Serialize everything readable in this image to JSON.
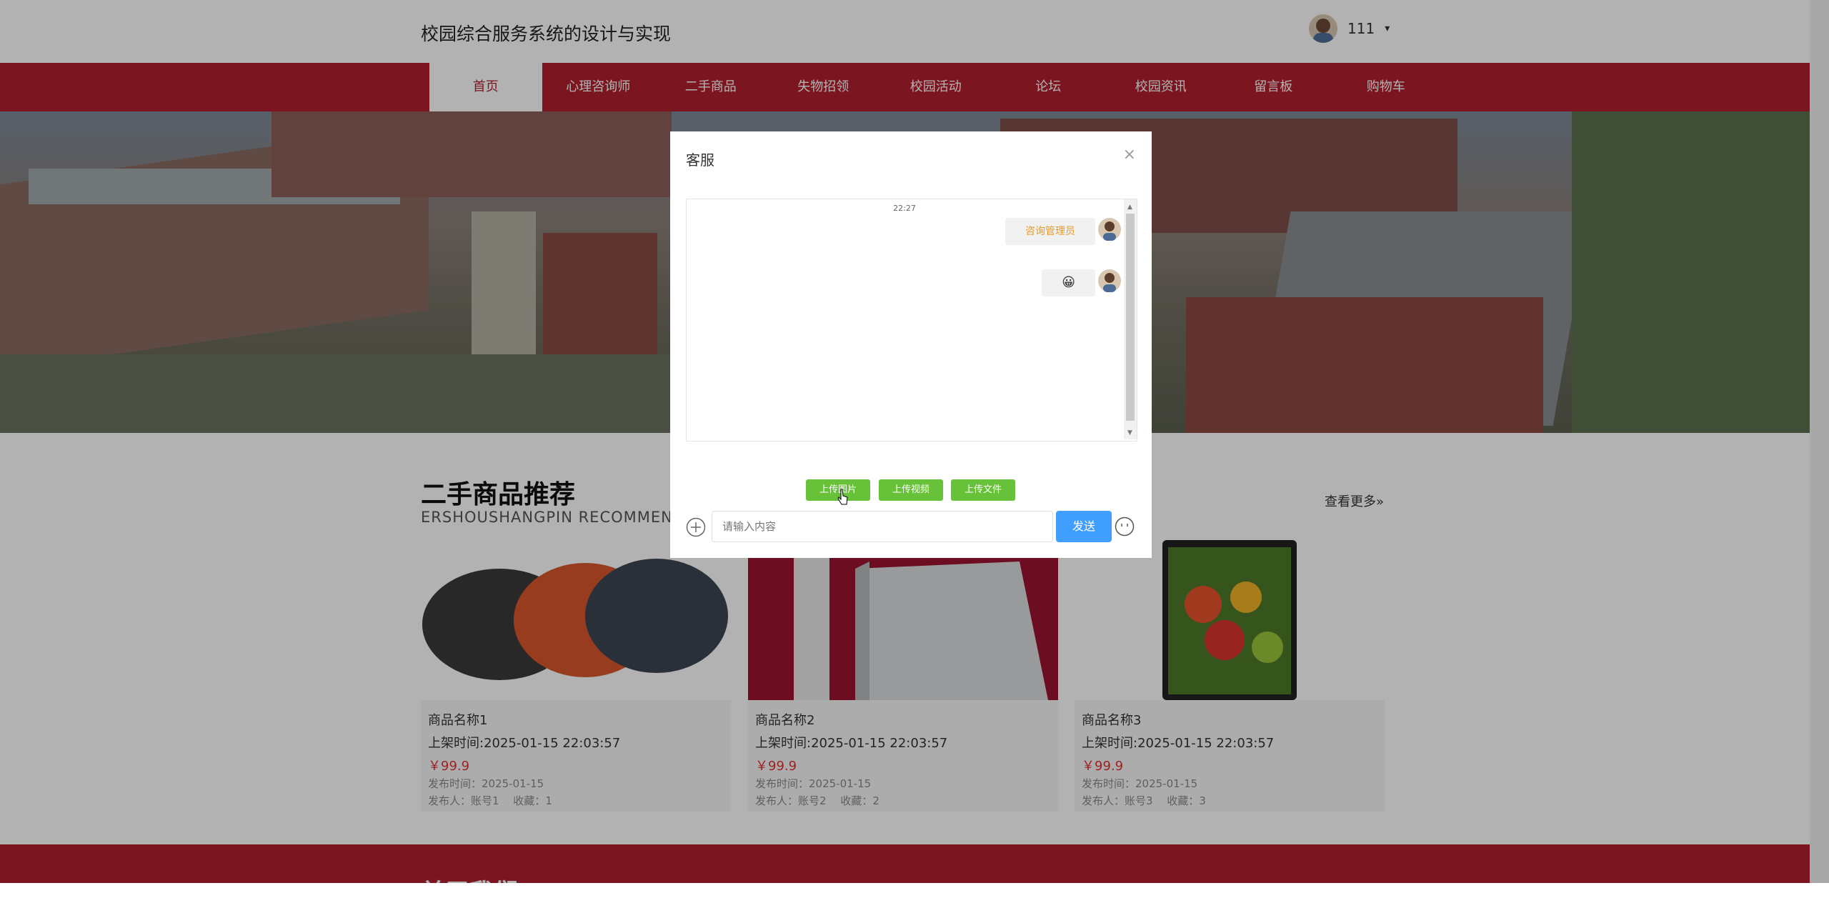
{
  "header": {
    "title": "校园综合服务系统的设计与实现",
    "username": "111",
    "caret": "▾"
  },
  "nav": {
    "items": [
      {
        "label": "首页",
        "active": true
      },
      {
        "label": "心理咨询师"
      },
      {
        "label": "二手商品"
      },
      {
        "label": "失物招领"
      },
      {
        "label": "校园活动"
      },
      {
        "label": "论坛"
      },
      {
        "label": "校园资讯"
      },
      {
        "label": "留言板"
      },
      {
        "label": "购物车"
      }
    ]
  },
  "section": {
    "title": "二手商品推荐",
    "subtitle": "ERSHOUSHANGPIN RECOMMEND",
    "more": "查看更多»"
  },
  "products": [
    {
      "name": "商品名称1",
      "time": "上架时间:2025-01-15 22:03:57",
      "price": "￥99.9",
      "published": "发布时间：2025-01-15",
      "publisher": "发布人：账号1　 收藏：1"
    },
    {
      "name": "商品名称2",
      "time": "上架时间:2025-01-15 22:03:57",
      "price": "￥99.9",
      "published": "发布时间：2025-01-15",
      "publisher": "发布人：账号2　 收藏：2"
    },
    {
      "name": "商品名称3",
      "time": "上架时间:2025-01-15 22:03:57",
      "price": "￥99.9",
      "published": "发布时间：2025-01-15",
      "publisher": "发布人：账号3　 收藏：3"
    }
  ],
  "footer": {
    "title": "关于我们"
  },
  "dialog": {
    "title": "客服",
    "close": "×",
    "chat_time": "22:27",
    "messages": [
      {
        "text": "咨询管理员"
      },
      {
        "text": "😀"
      }
    ],
    "buttons": {
      "upload_image": "上传图片",
      "upload_video": "上传视频",
      "upload_file": "上传文件"
    },
    "input_placeholder": "请输入内容",
    "send": "发送"
  },
  "colors": {
    "primary": "#b0202e",
    "send": "#409eff",
    "upload": "#67c23a",
    "price": "#e0302e"
  }
}
